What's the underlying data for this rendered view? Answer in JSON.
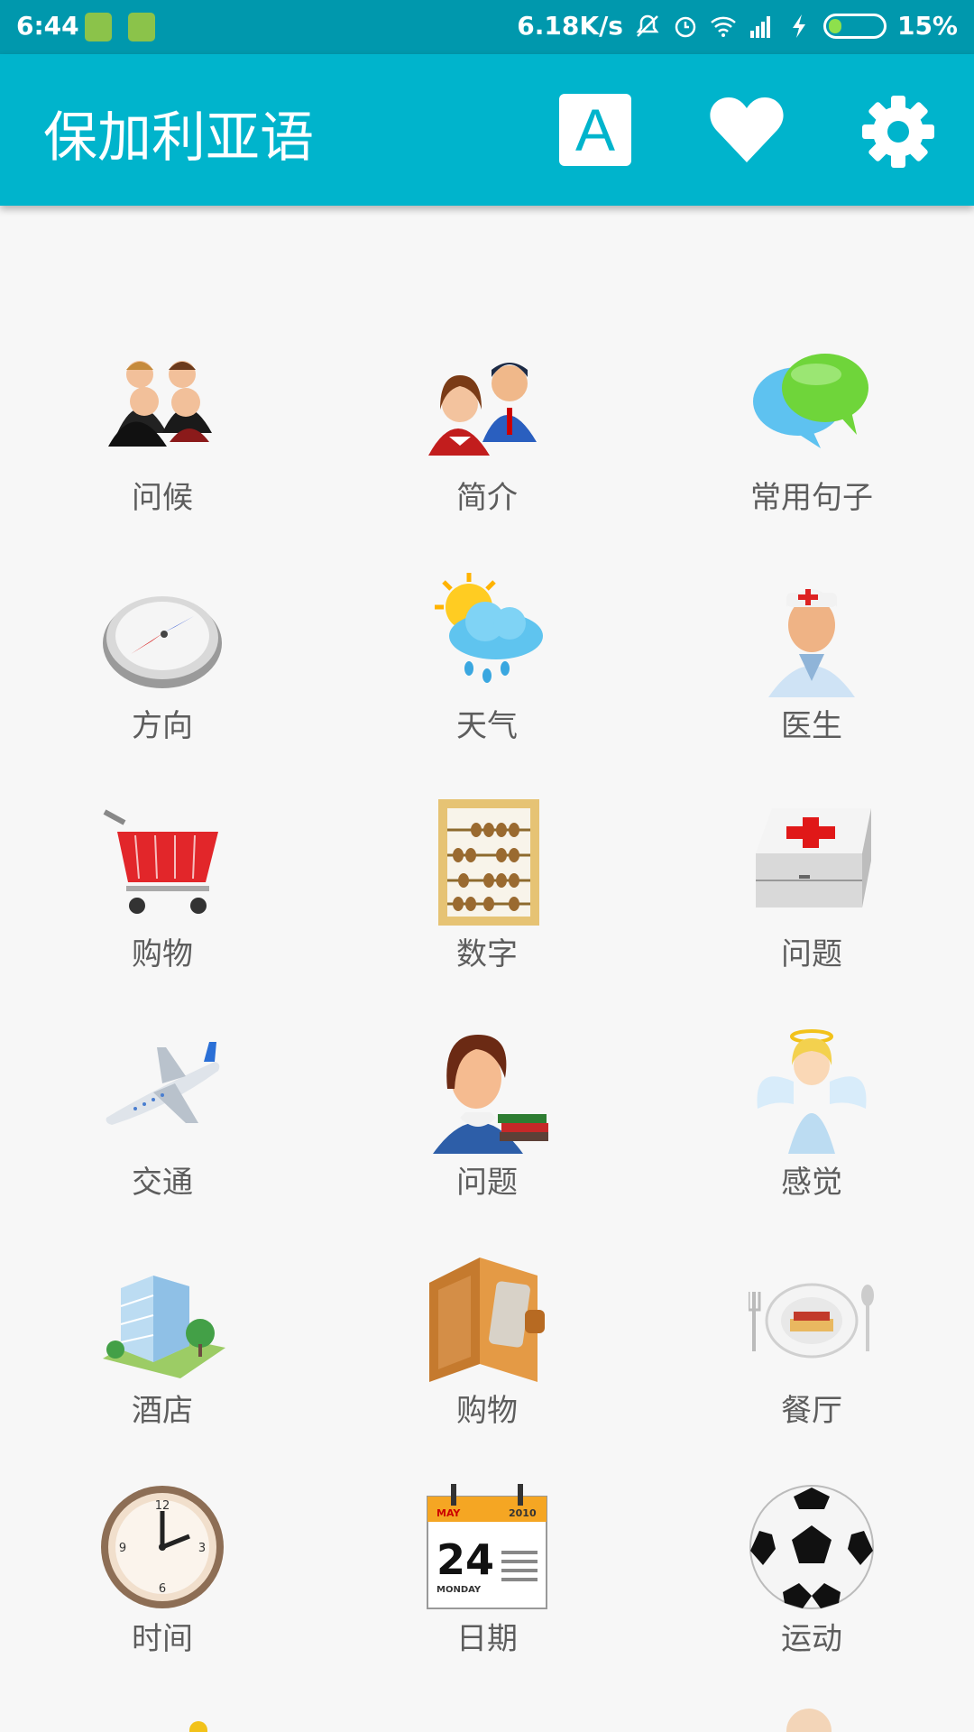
{
  "status_bar": {
    "time": "6:44",
    "network_speed": "6.18K/s",
    "battery_percent": "15%",
    "icons": [
      "sim-icon",
      "android-icon",
      "mute-icon",
      "alarm-icon",
      "wifi-icon",
      "signal-icon",
      "charging-icon",
      "battery-icon"
    ]
  },
  "app_bar": {
    "title": "保加利亚语",
    "font_button_label": "A",
    "favorites_icon": "heart-icon",
    "settings_icon": "gear-icon"
  },
  "colors": {
    "status_bar": "#0098ad",
    "app_bar": "#00b4cc",
    "background": "#f7f7f7",
    "label_text": "#5d5d5d"
  },
  "categories": [
    {
      "label": "问候",
      "icon": "people-meeting-icon"
    },
    {
      "label": "简介",
      "icon": "couple-icon"
    },
    {
      "label": "常用句子",
      "icon": "chat-bubbles-icon"
    },
    {
      "label": "方向",
      "icon": "compass-icon"
    },
    {
      "label": "天气",
      "icon": "weather-icon"
    },
    {
      "label": "医生",
      "icon": "doctor-icon"
    },
    {
      "label": "购物",
      "icon": "shopping-cart-icon"
    },
    {
      "label": "数字",
      "icon": "abacus-icon"
    },
    {
      "label": "问题",
      "icon": "first-aid-kit-icon"
    },
    {
      "label": "交通",
      "icon": "airplane-icon"
    },
    {
      "label": "问题",
      "icon": "teacher-icon"
    },
    {
      "label": "感觉",
      "icon": "angel-icon"
    },
    {
      "label": "酒店",
      "icon": "hotel-icon"
    },
    {
      "label": "购物",
      "icon": "wallet-icon"
    },
    {
      "label": "餐厅",
      "icon": "restaurant-plate-icon"
    },
    {
      "label": "时间",
      "icon": "clock-icon"
    },
    {
      "label": "日期",
      "icon": "calendar-icon"
    },
    {
      "label": "运动",
      "icon": "soccer-ball-icon"
    }
  ],
  "calendar_icon_text": {
    "month": "MAY",
    "year": "2010",
    "day": "24",
    "weekday": "MONDAY"
  }
}
